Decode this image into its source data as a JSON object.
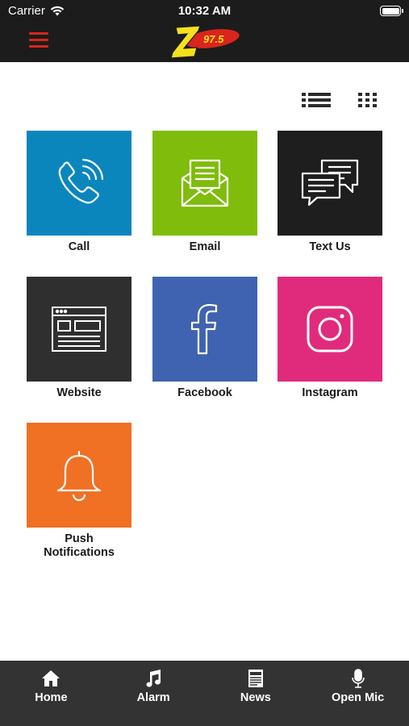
{
  "status": {
    "carrier": "Carrier",
    "time": "10:32 AM"
  },
  "header": {
    "logo_text": "Z",
    "logo_sub": "97.5"
  },
  "colors": {
    "header_bg": "#1c1c1c",
    "menu_red": "#d9251c",
    "call": "#0b86bd",
    "email": "#7fbc0b",
    "text": "#1e1e1e",
    "website": "#2f2f2f",
    "facebook": "#3f63b0",
    "instagram": "#e02b7c",
    "push": "#f07024",
    "tabbar": "#333333"
  },
  "tiles": [
    {
      "label": "Call",
      "icon": "phone-icon"
    },
    {
      "label": "Email",
      "icon": "envelope-icon"
    },
    {
      "label": "Text Us",
      "icon": "chat-bubbles-icon"
    },
    {
      "label": "Website",
      "icon": "browser-window-icon"
    },
    {
      "label": "Facebook",
      "icon": "facebook-icon"
    },
    {
      "label": "Instagram",
      "icon": "instagram-icon"
    },
    {
      "label": "Push Notifications",
      "label_line1": "Push",
      "label_line2": "Notifications",
      "icon": "bell-icon"
    }
  ],
  "tabs": [
    {
      "label": "Home",
      "icon": "home-icon"
    },
    {
      "label": "Alarm",
      "icon": "music-note-icon"
    },
    {
      "label": "News",
      "icon": "newspaper-icon"
    },
    {
      "label": "Open Mic",
      "icon": "microphone-icon"
    }
  ]
}
